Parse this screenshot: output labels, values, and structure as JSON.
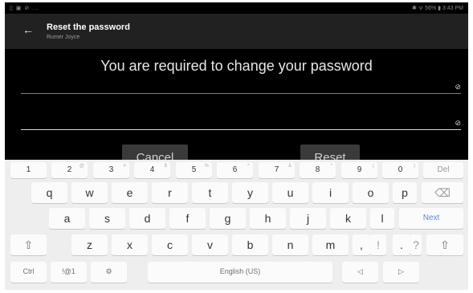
{
  "status": {
    "left": "▯ ▣ ⊘ ...",
    "right": "✱ ᯤ 56% ▮ 3:43 PM"
  },
  "appbar": {
    "title": "Reset the password",
    "subtitle": "Rumer Joyce"
  },
  "main": {
    "message": "You are required to change your password",
    "password_field_value": "",
    "confirm_field_value": ""
  },
  "buttons": {
    "cancel": "Cancel",
    "reset": "Reset"
  },
  "icons": {
    "back": "back-arrow-icon",
    "visibility": "eye-off-icon"
  },
  "keyboard": {
    "row0": [
      {
        "k": "1",
        "s": ""
      },
      {
        "k": "2",
        "s": "@"
      },
      {
        "k": "3",
        "s": "#"
      },
      {
        "k": "4",
        "s": "$"
      },
      {
        "k": "5",
        "s": "%"
      },
      {
        "k": "6",
        "s": "^"
      },
      {
        "k": "7",
        "s": "&"
      },
      {
        "k": "8",
        "s": "*"
      },
      {
        "k": "9",
        "s": "("
      },
      {
        "k": "0",
        "s": ")"
      },
      {
        "k": "Del",
        "s": ""
      }
    ],
    "row1": [
      "q",
      "w",
      "e",
      "r",
      "t",
      "y",
      "u",
      "i",
      "o",
      "p",
      "⌫"
    ],
    "row2": [
      "a",
      "s",
      "d",
      "f",
      "g",
      "h",
      "j",
      "k",
      "l",
      "Next"
    ],
    "row3": [
      "⇧",
      "z",
      "x",
      "c",
      "v",
      "b",
      "n",
      "m",
      ",",
      "!",
      ".",
      "?",
      "⇧"
    ],
    "row4": {
      "ctrl": "Ctrl",
      "sym": "!@1",
      "settings": "⚙",
      "space": "English (US)",
      "left": "◁",
      "right": "▷"
    }
  }
}
